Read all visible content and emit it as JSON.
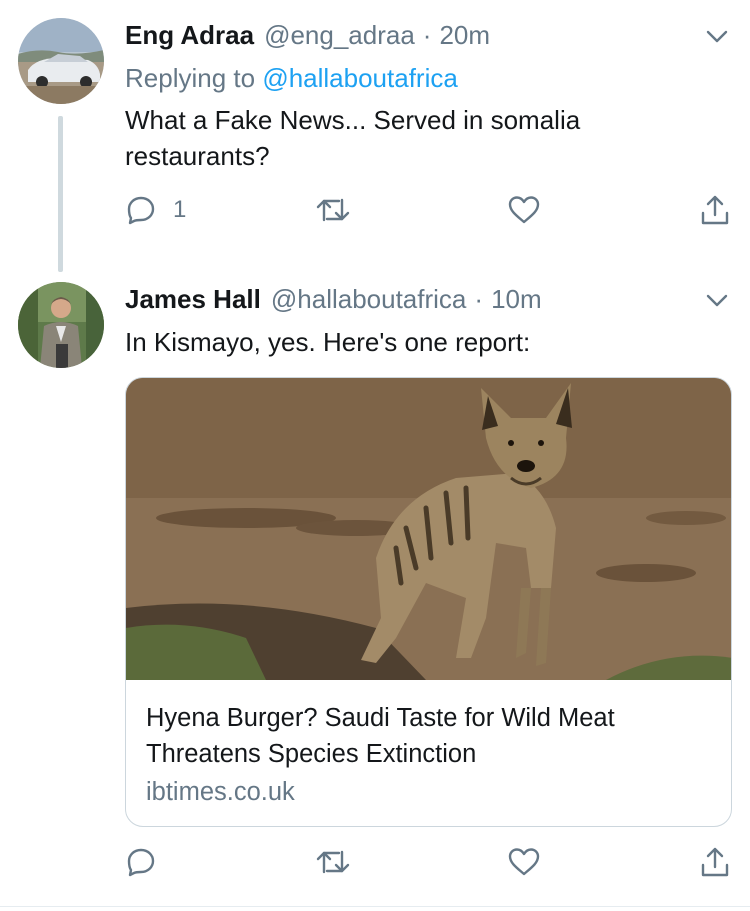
{
  "tweets": [
    {
      "name": "Eng Adraa",
      "handle": "@eng_adraa",
      "separator": "·",
      "time": "20m",
      "replying_prefix": "Replying to ",
      "replying_handle": "@hallaboutafrica",
      "text": "What a Fake News... Served in somalia restaurants?",
      "reply_count": "1"
    },
    {
      "name": "James Hall",
      "handle": "@hallaboutafrica",
      "separator": "·",
      "time": "10m",
      "text": "In Kismayo, yes. Here's one report:",
      "card": {
        "title": "Hyena Burger? Saudi Taste for Wild Meat Threatens Species Extinction",
        "domain": "ibtimes.co.uk"
      }
    }
  ],
  "icons": [
    "chevron-down-icon",
    "reply-icon",
    "retweet-icon",
    "like-icon",
    "share-icon"
  ],
  "colors": {
    "text": "#14171a",
    "secondary": "#657786",
    "link": "#1da1f2",
    "thread_line": "#cfd9de",
    "card_border": "#ccd6dd"
  }
}
